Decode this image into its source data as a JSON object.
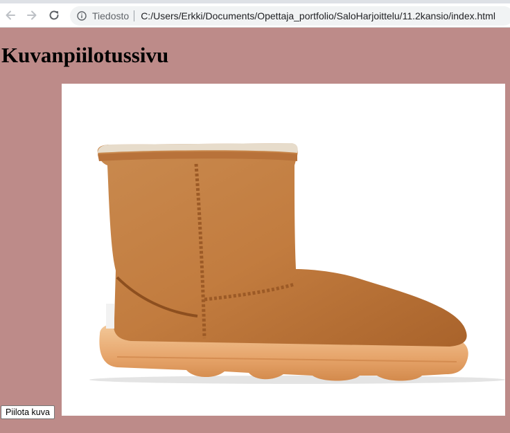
{
  "browser": {
    "scheme_label": "Tiedosto",
    "url": "C:/Users/Erkki/Documents/Opettaja_portfolio/SaloHarjoittelu/11.2kansio/index.html"
  },
  "page": {
    "title": "Kuvanpiilotussivu",
    "image_alt": "boot",
    "hide_button_label": "Piilota kuva",
    "background_color": "#bd8b89"
  }
}
